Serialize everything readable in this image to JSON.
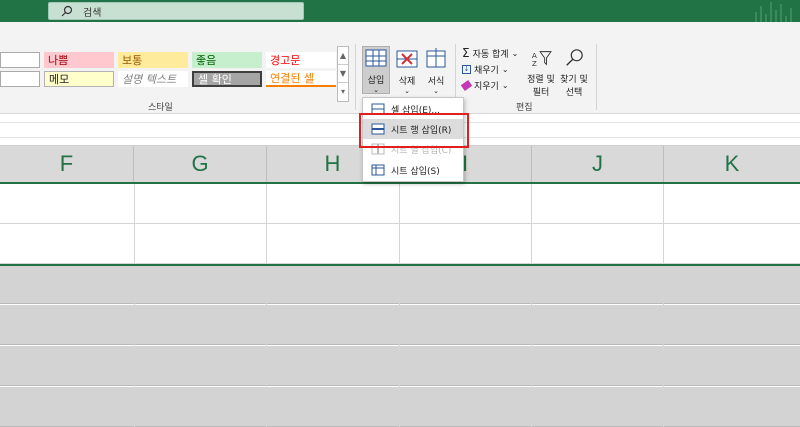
{
  "colors": {
    "accent": "#217346",
    "highlight": "#e02020",
    "selection": "#d3d3d3"
  },
  "search": {
    "placeholder": "검색"
  },
  "styles": {
    "group_label": "스타일",
    "items": [
      {
        "label": "나쁨",
        "bg": "#ffc7ce",
        "fg": "#9c0006"
      },
      {
        "label": "보통",
        "bg": "#ffeb9c",
        "fg": "#9c5700"
      },
      {
        "label": "좋음",
        "bg": "#c6efce",
        "fg": "#006100"
      },
      {
        "label": "경고문",
        "bg": "#ffffff",
        "fg": "#ff0000"
      },
      {
        "label": "메모",
        "bg": "#ffffcc",
        "fg": "#222222"
      },
      {
        "label": "설명 텍스트",
        "bg": "#ffffff",
        "fg": "#7f7f7f"
      },
      {
        "label": "셀 확인",
        "bg": "#a5a5a5",
        "fg": "#ffffff"
      },
      {
        "label": "연결된 셀",
        "bg": "#ffffff",
        "fg": "#fa7d00"
      }
    ]
  },
  "cells_group": {
    "insert": {
      "label": "삽입",
      "icon": "insert-cells-icon"
    },
    "delete": {
      "label": "삭제",
      "icon": "delete-cells-icon"
    },
    "format": {
      "label": "서식",
      "icon": "format-cells-icon"
    }
  },
  "editing": {
    "group_label": "편집",
    "autosum": "자동 합계",
    "fill": "채우기",
    "clear": "지우기",
    "sort_filter_line1": "정렬 및",
    "sort_filter_line2": "필터",
    "find_select_line1": "찾기 및",
    "find_select_line2": "선택"
  },
  "insert_menu": {
    "items": [
      {
        "label": "셀 삽입(E)...",
        "state": "normal"
      },
      {
        "label": "시트 행 삽입(R)",
        "state": "highlighted"
      },
      {
        "label": "시트 열 삽입(C)",
        "state": "disabled"
      },
      {
        "label": "시트 삽입(S)",
        "state": "normal"
      }
    ]
  },
  "columns": [
    "F",
    "G",
    "H",
    "I",
    "J",
    "K"
  ]
}
